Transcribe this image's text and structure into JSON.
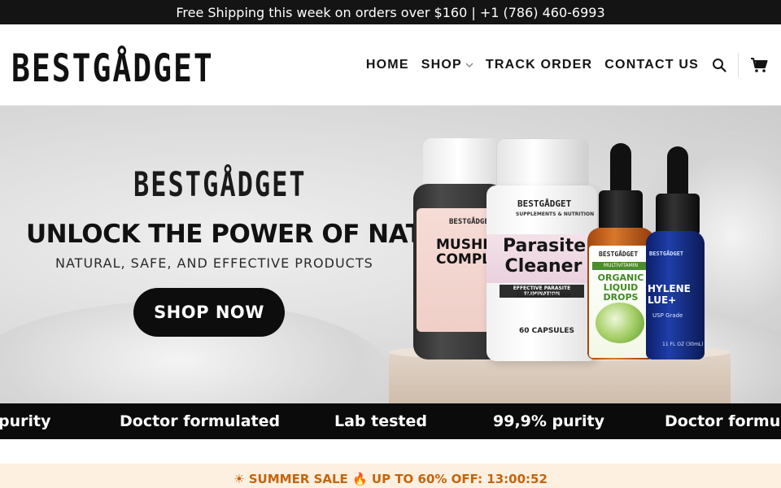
{
  "topbar": {
    "text": "Free Shipping this week on orders over $160 | +1 (786) 460-6993"
  },
  "header": {
    "logo": "BESTGÅDGET",
    "nav": [
      {
        "label": "HOME"
      },
      {
        "label": "SHOP"
      },
      {
        "label": "TRACK ORDER"
      },
      {
        "label": "CONTACT US"
      }
    ],
    "icons": [
      "chevron-down-icon",
      "search-icon",
      "cart-icon"
    ]
  },
  "hero": {
    "brand": "BESTGÅDGET",
    "title": "UNLOCK THE POWER OF NATURE",
    "subtitle": "NATURAL, SAFE, AND EFFECTIVE PRODUCTS",
    "cta": "SHOP NOW",
    "products": {
      "jar": {
        "brand": "BESTGÅDGET",
        "name": "MUSHRO\nCOMPL"
      },
      "bottle": {
        "brand": "BESTGÅDGET",
        "tagline": "SUPPLEMENTS & NUTRITION",
        "name": "Parasite Cleaner",
        "claim1": "EFFECTIVE PARASITE ELIMINATION",
        "claim2": "CLINICALLY TESTED",
        "count": "60 CAPSULES"
      },
      "dropper_orange": {
        "brand": "BESTGÅDGET",
        "band": "MULTIVITAMIN",
        "name": "ORGANIC LIQUID DROPS"
      },
      "dropper_blue": {
        "brand": "BESTGÅDGET",
        "name": "HYLENE LUE+",
        "grade": "USP Grade",
        "volume": "11 FL OZ (30mL)"
      }
    }
  },
  "ticker": {
    "items": [
      "purity",
      "Doctor formulated",
      "Lab tested",
      "99,9% purity",
      "Doctor formulat"
    ]
  },
  "sale": {
    "text": "☀ SUMMER SALE 🔥 UP TO 60% OFF: 13:00:52"
  },
  "colors": {
    "topbar_bg": "#141414",
    "ticker_bg": "#0b0b0b",
    "sale_bg": "#fdf0e1",
    "sale_text": "#c6640b"
  }
}
